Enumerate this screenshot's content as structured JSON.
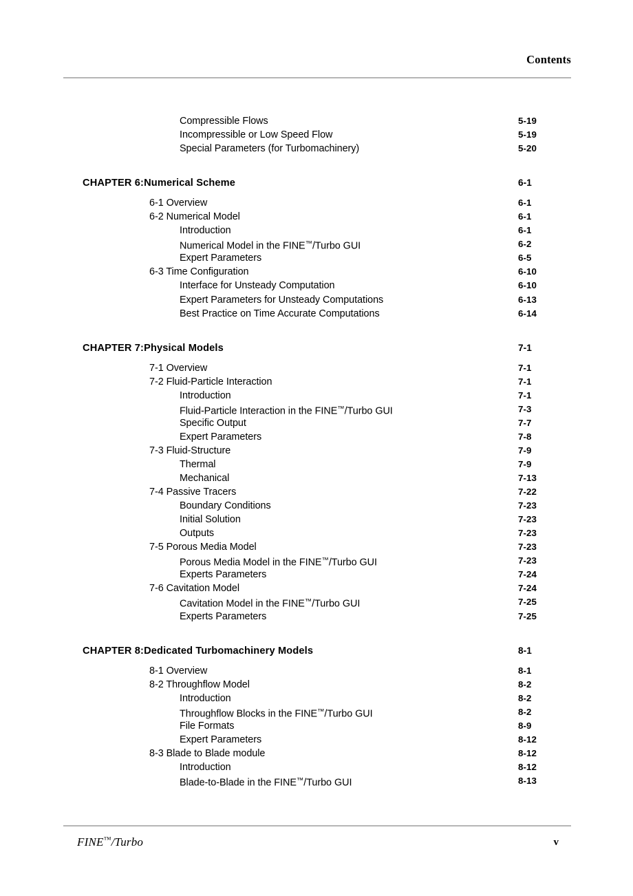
{
  "header": {
    "title": "Contents"
  },
  "footer": {
    "document_name_pre": "FINE",
    "document_name_tm": "™",
    "document_name_post": "/Turbo",
    "page_number": "v"
  },
  "toc": {
    "entries": [
      {
        "level": 3,
        "label": "Compressible Flows",
        "page": "5-19"
      },
      {
        "level": 3,
        "label": "Incompressible or Low Speed Flow",
        "page": "5-19"
      },
      {
        "level": 3,
        "label": "Special Parameters (for Turbomachinery)",
        "page": "5-20"
      },
      {
        "level": 1,
        "chapter_tag": "CHAPTER 6:",
        "label": "Numerical Scheme",
        "page": "6-1"
      },
      {
        "level": 2,
        "label": "6-1 Overview",
        "page": "6-1"
      },
      {
        "level": 2,
        "label": "6-2 Numerical Model",
        "page": "6-1"
      },
      {
        "level": 3,
        "label": "Introduction",
        "page": "6-1"
      },
      {
        "level": 3,
        "label": "Numerical Model in the FINE™/Turbo GUI",
        "page": "6-2",
        "tm_split": [
          "Numerical Model in the FINE",
          "/Turbo GUI"
        ]
      },
      {
        "level": 3,
        "label": "Expert Parameters",
        "page": "6-5"
      },
      {
        "level": 2,
        "label": "6-3 Time Configuration",
        "page": "6-10"
      },
      {
        "level": 3,
        "label": "Interface for Unsteady Computation",
        "page": "6-10"
      },
      {
        "level": 3,
        "label": "Expert Parameters for Unsteady Computations",
        "page": "6-13"
      },
      {
        "level": 3,
        "label": "Best Practice on Time Accurate Computations",
        "page": "6-14"
      },
      {
        "level": 1,
        "chapter_tag": "CHAPTER 7:",
        "label": "Physical Models",
        "page": "7-1"
      },
      {
        "level": 2,
        "label": "7-1 Overview",
        "page": "7-1"
      },
      {
        "level": 2,
        "label": "7-2 Fluid-Particle Interaction",
        "page": "7-1"
      },
      {
        "level": 3,
        "label": "Introduction",
        "page": "7-1"
      },
      {
        "level": 3,
        "label": "Fluid-Particle Interaction in the FINE™/Turbo GUI",
        "page": "7-3",
        "tm_split": [
          "Fluid-Particle Interaction in the FINE",
          "/Turbo GUI"
        ]
      },
      {
        "level": 3,
        "label": "Specific Output",
        "page": "7-7"
      },
      {
        "level": 3,
        "label": "Expert Parameters",
        "page": "7-8"
      },
      {
        "level": 2,
        "label": "7-3 Fluid-Structure",
        "page": "7-9"
      },
      {
        "level": 3,
        "label": "Thermal",
        "page": "7-9"
      },
      {
        "level": 3,
        "label": "Mechanical",
        "page": "7-13"
      },
      {
        "level": 2,
        "label": "7-4 Passive Tracers",
        "page": "7-22"
      },
      {
        "level": 3,
        "label": "Boundary Conditions",
        "page": "7-23"
      },
      {
        "level": 3,
        "label": "Initial Solution",
        "page": "7-23"
      },
      {
        "level": 3,
        "label": "Outputs",
        "page": "7-23"
      },
      {
        "level": 2,
        "label": "7-5 Porous Media Model",
        "page": "7-23"
      },
      {
        "level": 3,
        "label": "Porous Media Model in the FINE™/Turbo GUI",
        "page": "7-23",
        "tm_split": [
          "Porous Media Model in the FINE",
          "/Turbo GUI"
        ]
      },
      {
        "level": 3,
        "label": "Experts Parameters",
        "page": "7-24"
      },
      {
        "level": 2,
        "label": "7-6 Cavitation Model",
        "page": "7-24"
      },
      {
        "level": 3,
        "label": "Cavitation Model in the FINE™/Turbo GUI",
        "page": "7-25",
        "tm_split": [
          "Cavitation Model in the FINE",
          "/Turbo GUI"
        ]
      },
      {
        "level": 3,
        "label": "Experts Parameters",
        "page": "7-25"
      },
      {
        "level": 1,
        "chapter_tag": "CHAPTER 8:",
        "label": "Dedicated Turbomachinery Models",
        "page": "8-1"
      },
      {
        "level": 2,
        "label": "8-1 Overview",
        "page": "8-1"
      },
      {
        "level": 2,
        "label": "8-2 Throughflow Model",
        "page": "8-2"
      },
      {
        "level": 3,
        "label": "Introduction",
        "page": "8-2"
      },
      {
        "level": 3,
        "label": "Throughflow Blocks in the FINE™/Turbo GUI",
        "page": "8-2",
        "tm_split": [
          "Throughflow Blocks in the FINE",
          "/Turbo GUI"
        ]
      },
      {
        "level": 3,
        "label": "File Formats",
        "page": "8-9"
      },
      {
        "level": 3,
        "label": "Expert Parameters",
        "page": "8-12"
      },
      {
        "level": 2,
        "label": "8-3 Blade to Blade module",
        "page": "8-12"
      },
      {
        "level": 3,
        "label": "Introduction",
        "page": "8-12"
      },
      {
        "level": 3,
        "label": "Blade-to-Blade in the FINE™/Turbo GUI",
        "page": "8-13",
        "tm_split": [
          "Blade-to-Blade in the FINE",
          "/Turbo GUI"
        ]
      }
    ]
  }
}
